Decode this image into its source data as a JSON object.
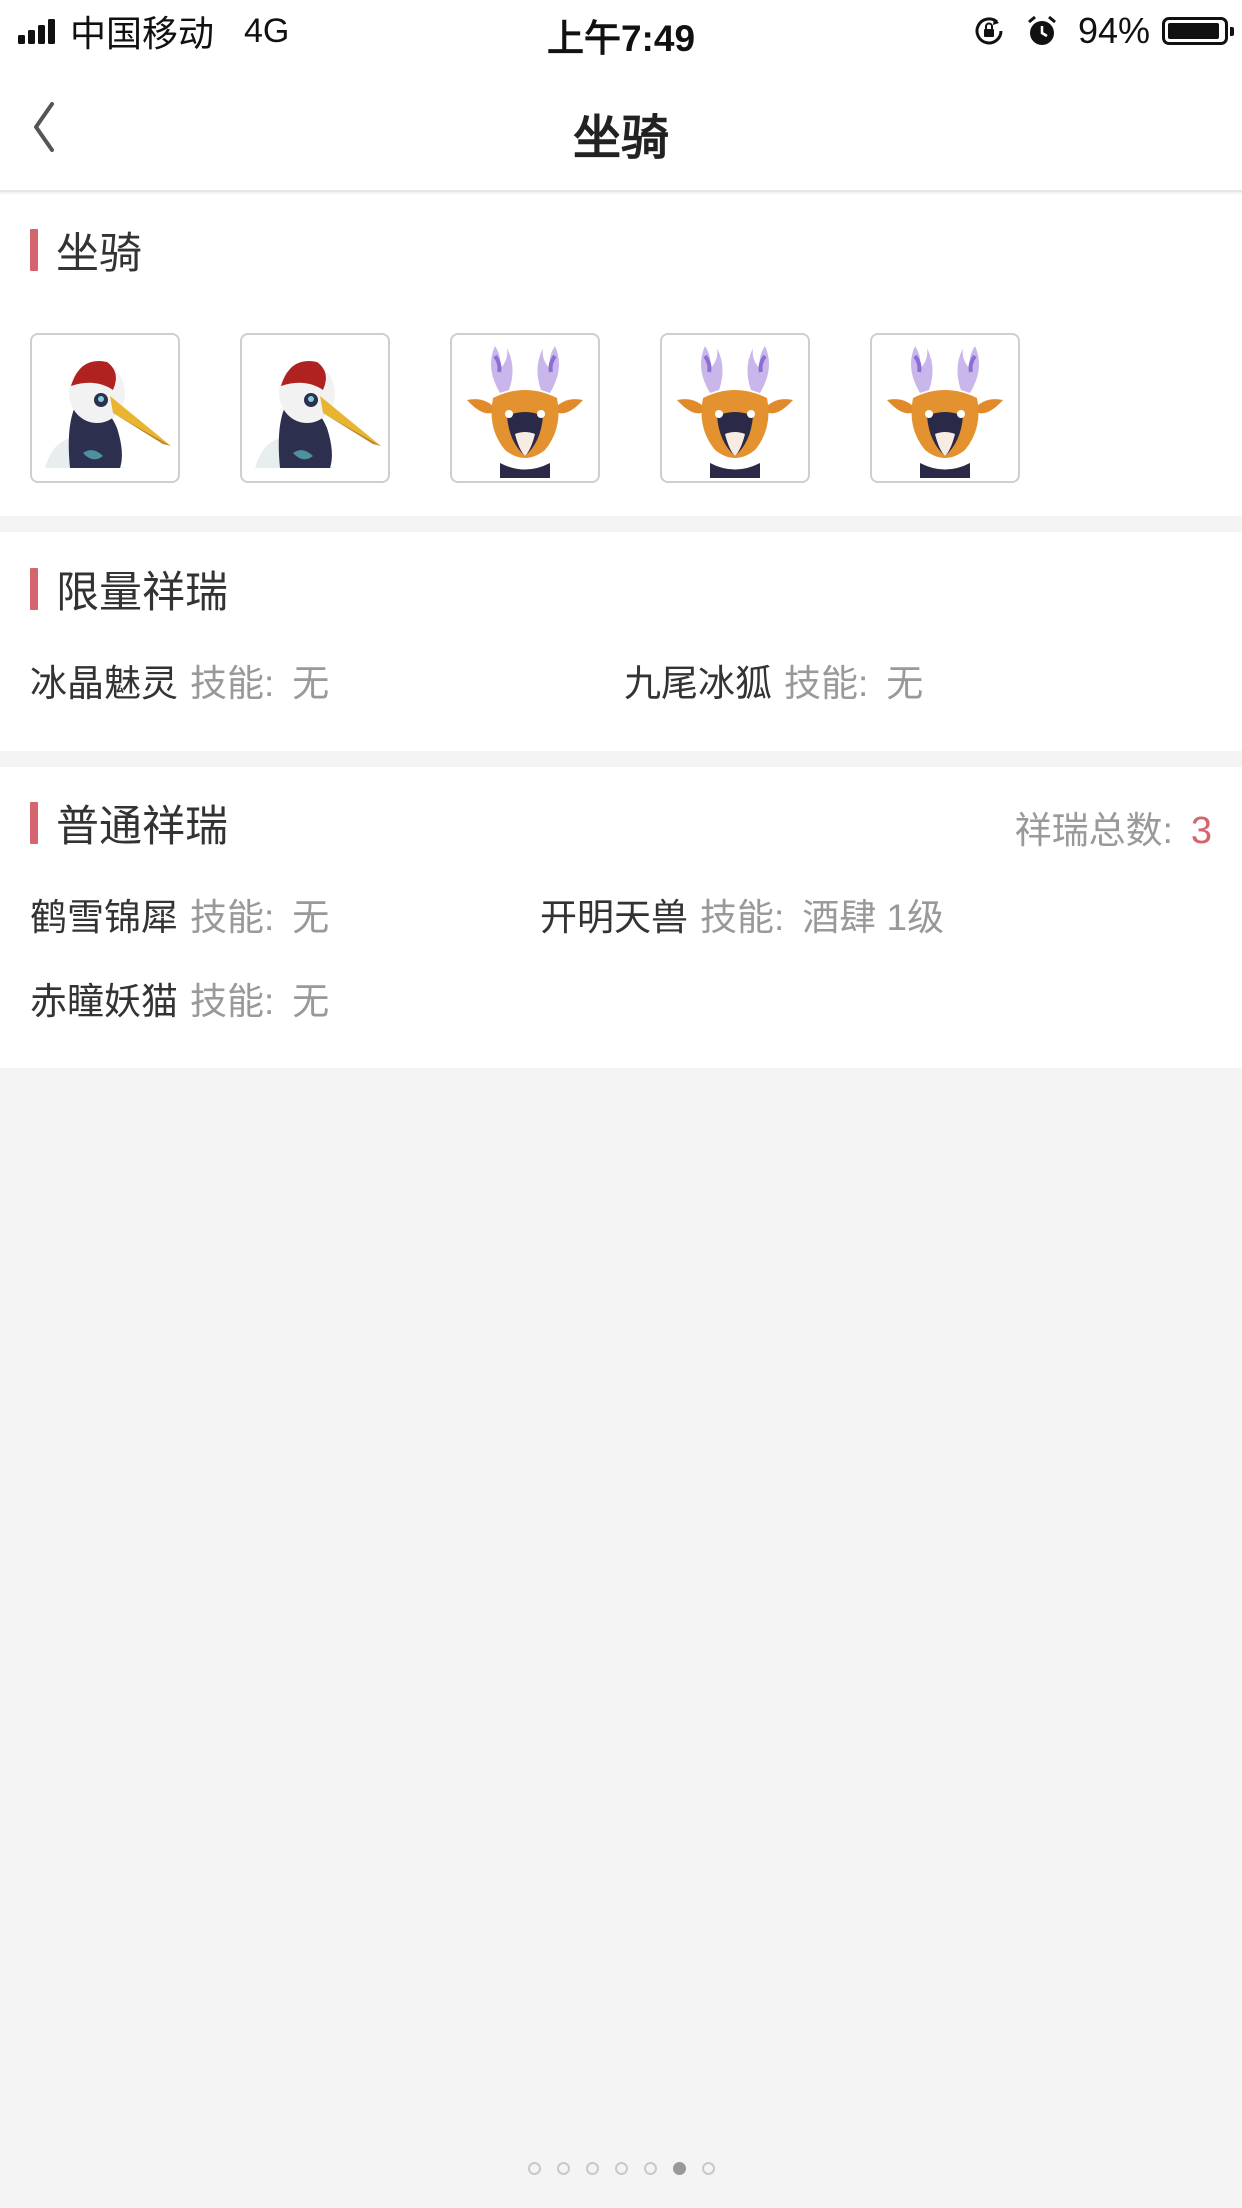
{
  "status_bar": {
    "carrier": "中国移动",
    "network": "4G",
    "time": "上午7:49",
    "battery": "94%",
    "battery_level": 0.94
  },
  "nav": {
    "title": "坐骑",
    "back_icon": "chevron-left-icon"
  },
  "mounts_section": {
    "title": "坐骑",
    "mounts": [
      {
        "icon": "crane-mount-icon"
      },
      {
        "icon": "crane-mount-icon"
      },
      {
        "icon": "deer-mount-icon"
      },
      {
        "icon": "deer-mount-icon"
      },
      {
        "icon": "deer-mount-icon"
      }
    ]
  },
  "limited_section": {
    "title": "限量祥瑞",
    "items": [
      {
        "name": "冰晶魅灵",
        "skill_label": "技能:",
        "skill": "无"
      },
      {
        "name": "九尾冰狐",
        "skill_label": "技能:",
        "skill": "无"
      }
    ]
  },
  "normal_section": {
    "title": "普通祥瑞",
    "total_label": "祥瑞总数:",
    "total": "3",
    "items": [
      {
        "name": "鹤雪锦犀",
        "skill_label": "技能:",
        "skill": "无"
      },
      {
        "name": "开明天兽",
        "skill_label": "技能:",
        "skill": "酒肆 1级"
      },
      {
        "name": "赤瞳妖猫",
        "skill_label": "技能:",
        "skill": "无"
      }
    ]
  },
  "pagination": {
    "total": 7,
    "active_index": 5
  },
  "colors": {
    "accent": "#d4646d",
    "muted": "#999999",
    "background": "#f4f4f4"
  }
}
